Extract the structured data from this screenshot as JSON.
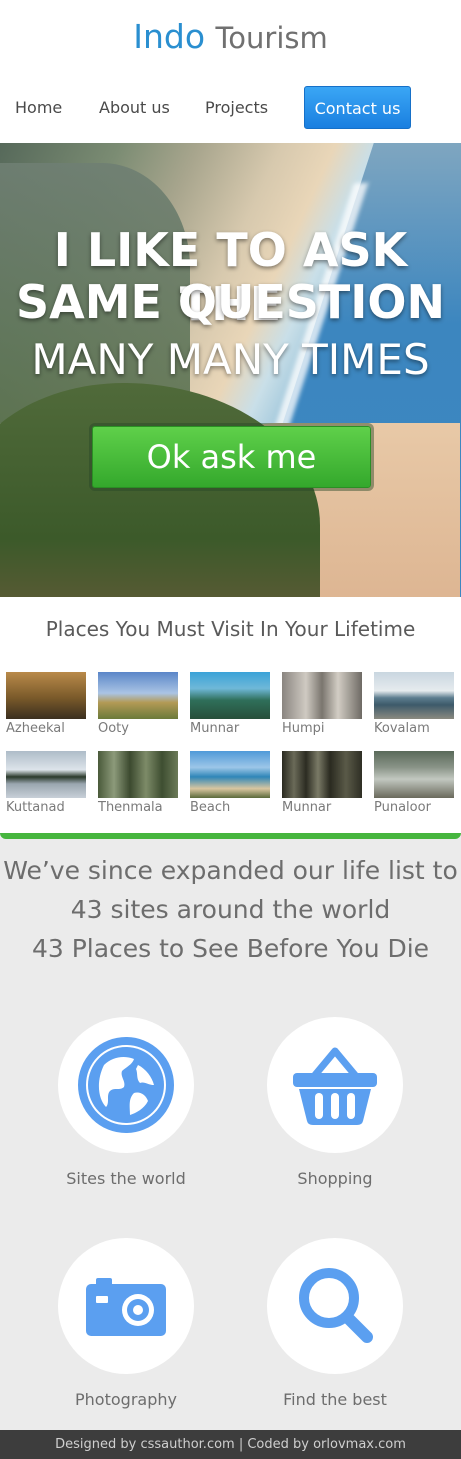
{
  "header": {
    "logo_brand": "Indo",
    "logo_rest": "Tourism",
    "nav": [
      "Home",
      "About us",
      "Projects",
      "Contact us"
    ]
  },
  "hero": {
    "line1": "I LIKE TO ASK THE",
    "line2": "SAME QUESTION",
    "line3": "MANY MANY TIMES",
    "cta_label": "Ok ask me"
  },
  "places": {
    "title": "Places You Must Visit In Your Lifetime",
    "items": [
      {
        "caption": "Azheekal"
      },
      {
        "caption": "Ooty"
      },
      {
        "caption": "Munnar"
      },
      {
        "caption": "Humpi"
      },
      {
        "caption": "Kovalam"
      },
      {
        "caption": "Kuttanad"
      },
      {
        "caption": "Thenmala"
      },
      {
        "caption": "Beach"
      },
      {
        "caption": "Munnar"
      },
      {
        "caption": "Punaloor"
      }
    ]
  },
  "expanded": {
    "line1": "We’ve since expanded our life list to",
    "line2": "43 sites around the world",
    "line3": "43 Places to See Before You Die"
  },
  "features": [
    {
      "label": "Sites the world",
      "icon": "globe-icon"
    },
    {
      "label": "Shopping",
      "icon": "basket-icon"
    },
    {
      "label": "Photography",
      "icon": "camera-icon"
    },
    {
      "label": "Find the best",
      "icon": "search-icon"
    }
  ],
  "colors": {
    "accent_blue": "#2a8fd0",
    "icon_blue": "#5b9ff0",
    "cta_green": "#46b53e",
    "footer_bg": "#3d3d3d"
  },
  "footer": {
    "text": "Designed by cssauthor.com | Coded by orlovmax.com"
  }
}
